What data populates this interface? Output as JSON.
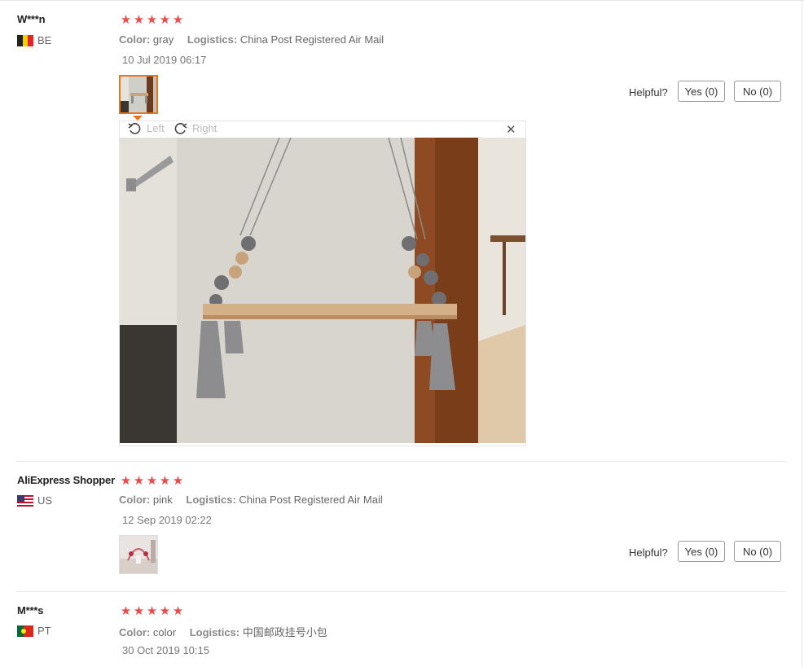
{
  "reviews": [
    {
      "user": "W***n",
      "country": "BE",
      "rating": 5,
      "color_label": "Color:",
      "color_value": "gray",
      "logistics_label": "Logistics:",
      "logistics_value": "China Post Registered Air Mail",
      "date": "10 Jul 2019 06:17",
      "helpful_label": "Helpful?",
      "yes_label": "Yes (0)",
      "no_label": "No (0)",
      "viewer": {
        "rotate_left_label": "Left",
        "rotate_right_label": "Right",
        "close_icon": "close-icon"
      }
    },
    {
      "user": "AliExpress Shopper",
      "country": "US",
      "rating": 5,
      "color_label": "Color:",
      "color_value": "pink",
      "logistics_label": "Logistics:",
      "logistics_value": "China Post Registered Air Mail",
      "date": "12 Sep 2019 02:22",
      "helpful_label": "Helpful?",
      "yes_label": "Yes (0)",
      "no_label": "No (0)"
    },
    {
      "user": "M***s",
      "country": "PT",
      "rating": 5,
      "color_label": "Color:",
      "color_value": "color",
      "logistics_label": "Logistics:",
      "logistics_value": "中国邮政挂号小包",
      "date": "30 Oct 2019 10:15"
    }
  ],
  "colors": {
    "star": "#f0494a",
    "active_thumb_border": "#e97319"
  }
}
